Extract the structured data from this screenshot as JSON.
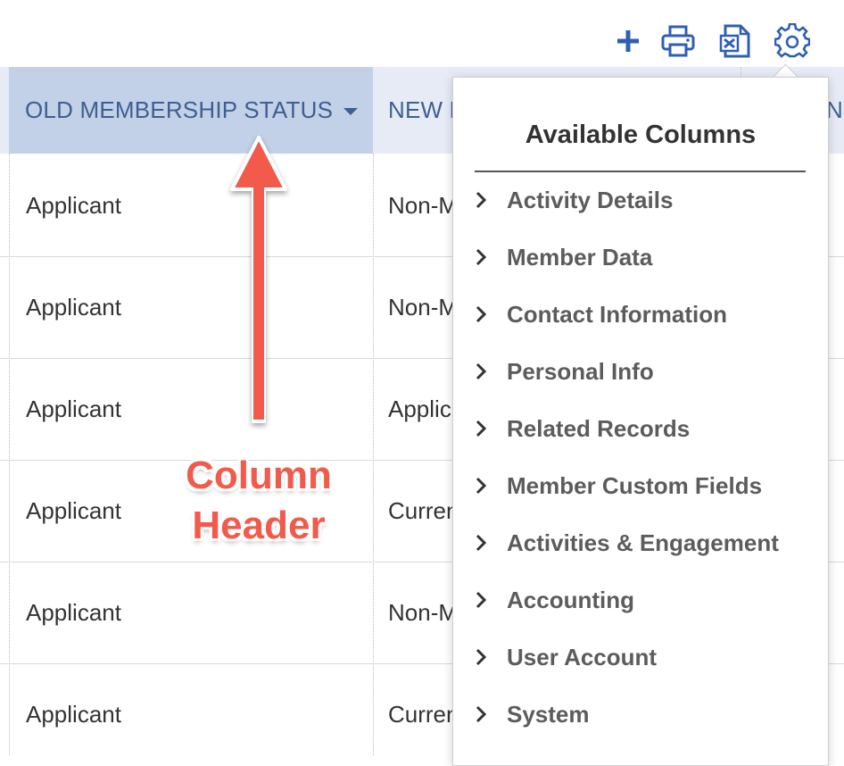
{
  "toolbar": {
    "icons": [
      "plus-icon",
      "print-icon",
      "excel-icon",
      "gear-icon"
    ],
    "accent": "#2f5fb3"
  },
  "grid": {
    "columns": [
      {
        "label": "OLD MEMBERSHIP STATUS",
        "active": true
      },
      {
        "label": "NEW MEMBERSHIP STATUS",
        "active": false
      },
      {
        "label": "N",
        "active": false
      }
    ],
    "rows": [
      {
        "old": "Applicant",
        "new": "Non-Member"
      },
      {
        "old": "Applicant",
        "new": "Non-Member"
      },
      {
        "old": "Applicant",
        "new": "Applicant"
      },
      {
        "old": "Applicant",
        "new": "Current"
      },
      {
        "old": "Applicant",
        "new": "Non-Member"
      },
      {
        "old": "Applicant",
        "new": "Current"
      }
    ],
    "header_bg": "#e6ebf5",
    "active_header_bg": "#c2d0e8",
    "header_text_color": "#3f5f90"
  },
  "annotation": {
    "lines": [
      "Column",
      "Header"
    ],
    "color": "#f25a4c"
  },
  "panel": {
    "title": "Available Columns",
    "items": [
      "Activity Details",
      "Member Data",
      "Contact Information",
      "Personal Info",
      "Related Records",
      "Member Custom Fields",
      "Activities & Engagement",
      "Accounting",
      "User Account",
      "System"
    ]
  }
}
